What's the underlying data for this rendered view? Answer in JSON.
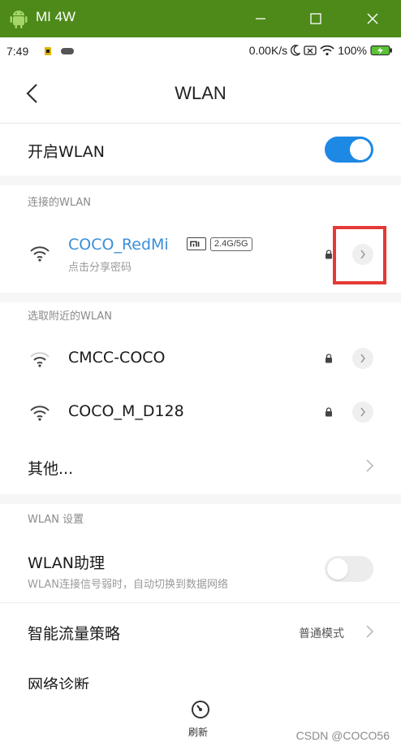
{
  "window": {
    "title": "MI 4W"
  },
  "status_bar": {
    "time": "7:49",
    "speed": "0.00K/s",
    "battery": "100%"
  },
  "header": {
    "title": "WLAN"
  },
  "wlan_toggle": {
    "label": "开启WLAN",
    "on": true
  },
  "connected_section": {
    "header": "连接的WLAN",
    "network": {
      "ssid": "COCO_RedMi",
      "band": "2.4G/5G",
      "hint": "点击分享密码"
    }
  },
  "nearby_section": {
    "header": "选取附近的WLAN",
    "networks": [
      {
        "ssid": "CMCC-COCO"
      },
      {
        "ssid": "COCO_M_D128"
      }
    ],
    "other_label": "其他..."
  },
  "settings_section": {
    "header": "WLAN 设置",
    "assistant": {
      "label": "WLAN助理",
      "desc": "WLAN连接信号弱时，自动切换到数据网络",
      "on": false
    },
    "traffic": {
      "label": "智能流量策略",
      "value": "普通模式"
    },
    "diagnose": {
      "label": "网络诊断"
    }
  },
  "bottom": {
    "refresh_label": "刷新"
  },
  "watermark": "CSDN @COCO56",
  "colors": {
    "titlebar": "#4d8a1a",
    "accent": "#3a8fd8",
    "toggle_on": "#1e88e5",
    "highlight": "#e53935"
  }
}
